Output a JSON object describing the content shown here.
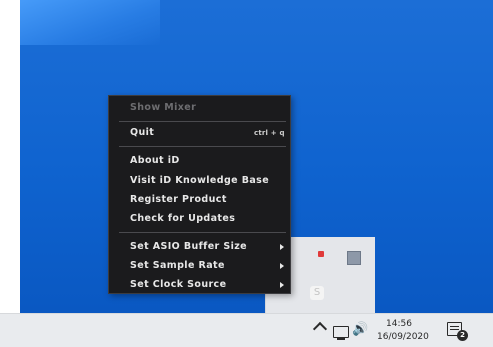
{
  "context_menu": {
    "items": [
      {
        "label": "Show Mixer",
        "enabled": false
      },
      {
        "label": "Quit",
        "shortcut": "ctrl + q"
      },
      {
        "label": "About iD"
      },
      {
        "label": "Visit iD Knowledge Base"
      },
      {
        "label": "Register Product"
      },
      {
        "label": "Check for Updates"
      },
      {
        "label": "Set ASIO Buffer Size",
        "submenu": true
      },
      {
        "label": "Set Sample Rate",
        "submenu": true
      },
      {
        "label": "Set Clock Source",
        "submenu": true
      }
    ]
  },
  "tray_overflow": {
    "icons": [
      "app-tray-icon",
      "square-tray-icon",
      "store-tray-icon"
    ],
    "store_glyph": "S"
  },
  "taskbar": {
    "icons": [
      "chevron-up-icon",
      "network-icon",
      "volume-icon"
    ],
    "volume_glyph": "🔊",
    "time": "14:56",
    "date": "16/09/2020",
    "notification_count": "2"
  },
  "colors": {
    "desktop": "#0f63cf",
    "menu_bg": "#1b1b1d",
    "taskbar": "#e9ebee"
  }
}
